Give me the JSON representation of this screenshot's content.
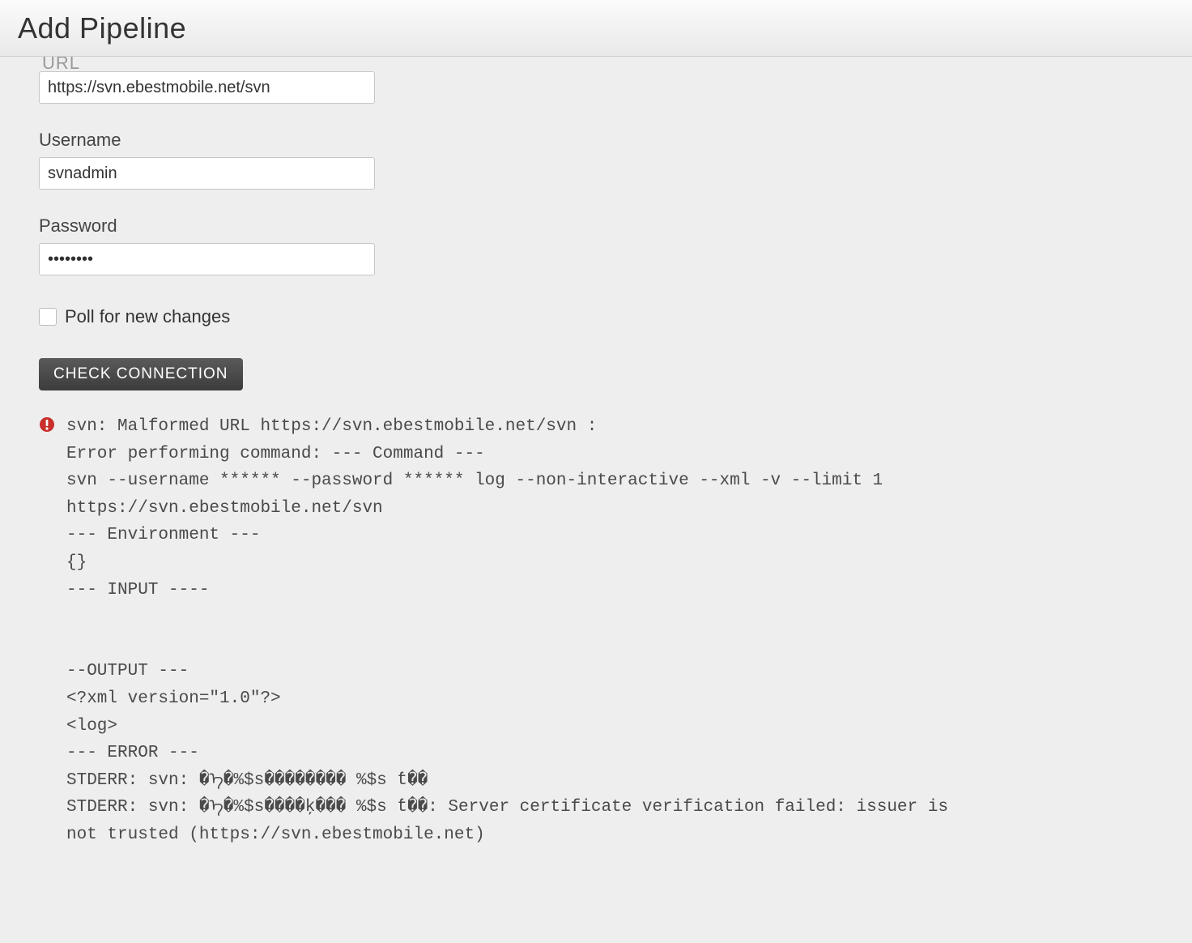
{
  "header": {
    "title": "Add Pipeline"
  },
  "form": {
    "url_label_cut": "URL",
    "url_value": "https://svn.ebestmobile.net/svn",
    "username_label": "Username",
    "username_value": "svnadmin",
    "password_label": "Password",
    "password_value": "••••••••",
    "poll_label": "Poll for new changes",
    "poll_checked": false,
    "check_connection_label": "CHECK CONNECTION"
  },
  "error": {
    "icon": "error-icon",
    "text": "svn: Malformed URL https://svn.ebestmobile.net/svn :\nError performing command: --- Command ---\nsvn --username ****** --password ****** log --non-interactive --xml -v --limit 1\nhttps://svn.ebestmobile.net/svn\n--- Environment ---\n{}\n--- INPUT ----\n\n\n--OUTPUT ---\n<?xml version=\"1.0\"?>\n<log>\n--- ERROR ---\nSTDERR: svn: �ᠡ�%$s�������� %$s ƭ��\nSTDERR: svn: �ᠡ�%$s����ķ��� %$s ƭ��: Server certificate verification failed: issuer is\nnot trusted (https://svn.ebestmobile.net)"
  }
}
